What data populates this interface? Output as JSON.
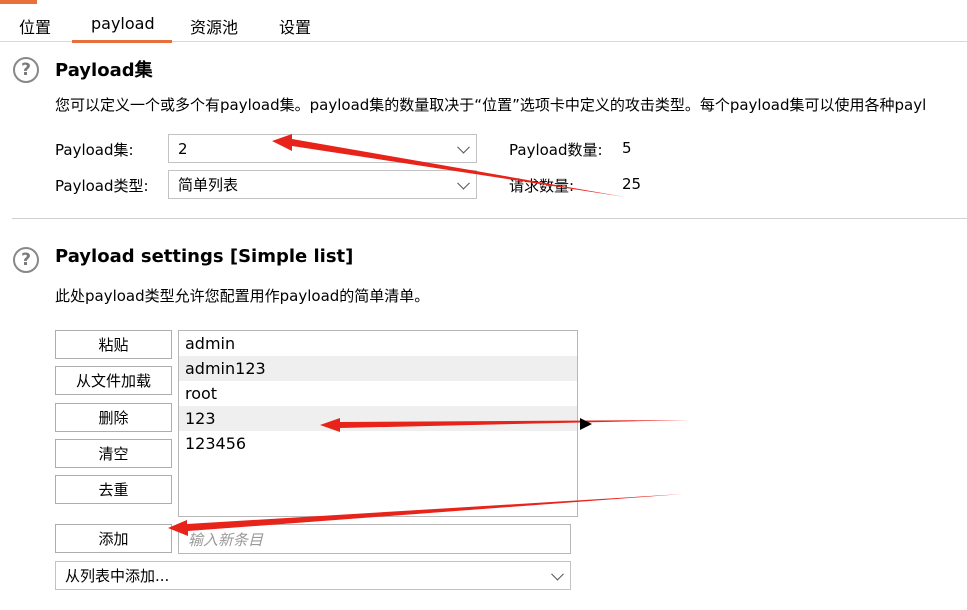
{
  "tabs": [
    {
      "label": "位置"
    },
    {
      "label": "payload"
    },
    {
      "label": "资源池"
    },
    {
      "label": "设置"
    }
  ],
  "payload_sets": {
    "title": "Payload集",
    "description": "您可以定义一个或多个有payload集。payload集的数量取决于“位置”选项卡中定义的攻击类型。每个payload集可以使用各种payl",
    "set_label": "Payload集:",
    "set_value": "2",
    "type_label": "Payload类型:",
    "type_value": "简单列表",
    "count_label": "Payload数量:",
    "count_value": "5",
    "requests_label": "请求数量:",
    "requests_value": "25"
  },
  "payload_settings": {
    "title": "Payload settings [Simple list]",
    "description": "此处payload类型允许您配置用作payload的简单清单。",
    "buttons": {
      "paste": "粘贴",
      "load": "从文件加载",
      "remove": "删除",
      "clear": "清空",
      "dedupe": "去重",
      "add": "添加"
    },
    "items": [
      "admin",
      "admin123",
      "root",
      "123",
      "123456"
    ],
    "new_item_placeholder": "输入新条目",
    "add_from_list": "从列表中添加..."
  },
  "colors": {
    "accent": "#e8703a",
    "annotation_arrow": "#e8231a",
    "row_alt": "#efefef"
  }
}
